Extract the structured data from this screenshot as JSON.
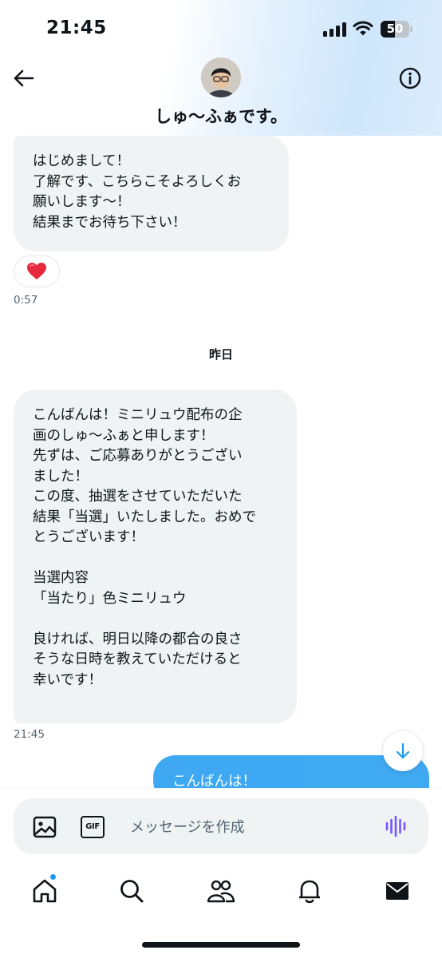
{
  "status_bar": {
    "time": "21:45",
    "battery": "50"
  },
  "header": {
    "contact_name": "しゅ〜ふぁです。",
    "avatar_alt": "avatar"
  },
  "messages": [
    {
      "direction": "incoming",
      "text": "はじめまして！\n了解です、こちらこそよろしくお\n願いします〜！\n結果までお待ち下さい！",
      "reaction": "❤️",
      "time": "0:57"
    },
    {
      "direction": "incoming",
      "text": "こんばんは！ミニリュウ配布の企\n画のしゅ〜ふぁと申します！\n先ずは、ご応募ありがとうござい\nました！\nこの度、抽選をさせていただいた\n結果「当選」いたしました。おめで\nとうございます！\n\n当選内容\n「当たり」色ミニリュウ\n\n良ければ、明日以降の都合の良さ\nそうな日時を教えていただけると\n幸いです！",
      "time": "21:45"
    },
    {
      "direction": "outgoing",
      "text": "こんばんは！"
    }
  ],
  "day_separator": "昨日",
  "composer": {
    "placeholder": "メッセージを作成",
    "gif_label": "GIF"
  },
  "tabs": [
    "home",
    "search",
    "communities",
    "notifications",
    "messages"
  ],
  "colors": {
    "accent": "#1d9bf0",
    "bubble_in": "#eff3f4",
    "text": "#0f1419",
    "secondary": "#536471",
    "voice": "#7856ff"
  }
}
